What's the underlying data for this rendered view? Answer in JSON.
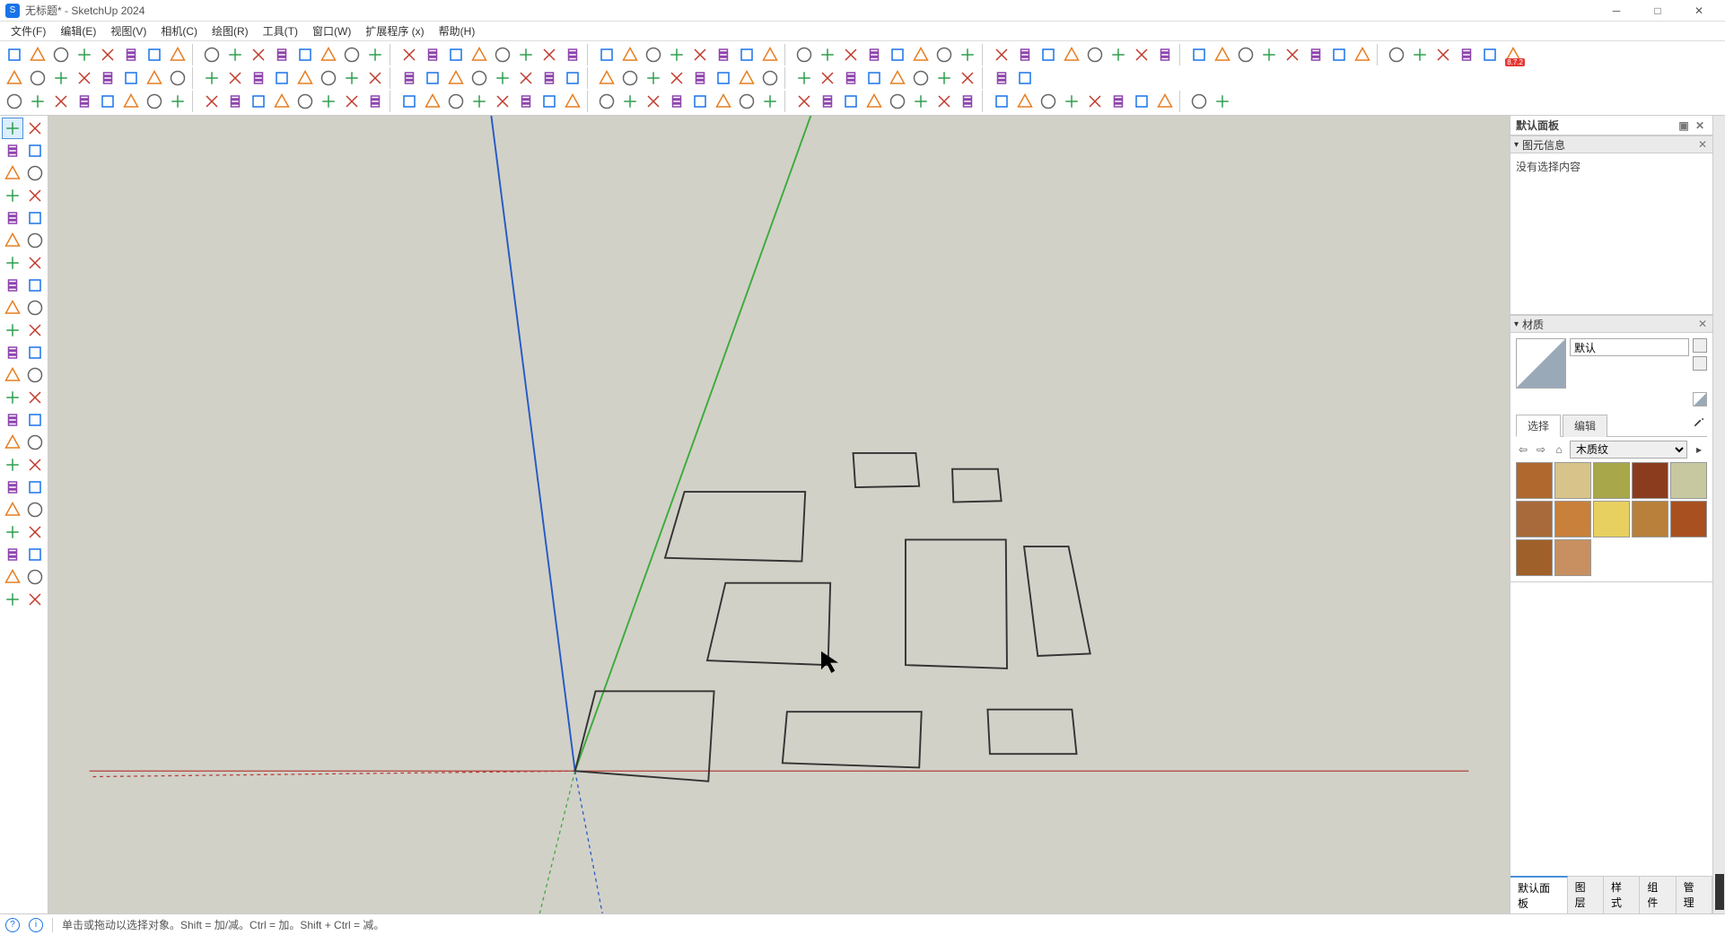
{
  "app": {
    "title": "无标题* - SketchUp 2024",
    "icon_letter": "S"
  },
  "menu": [
    {
      "label": "文件(F)",
      "key": "file"
    },
    {
      "label": "编辑(E)",
      "key": "edit"
    },
    {
      "label": "视图(V)",
      "key": "view"
    },
    {
      "label": "相机(C)",
      "key": "camera"
    },
    {
      "label": "绘图(R)",
      "key": "draw"
    },
    {
      "label": "工具(T)",
      "key": "tools"
    },
    {
      "label": "窗口(W)",
      "key": "window"
    },
    {
      "label": "扩展程序 (x)",
      "key": "ext"
    },
    {
      "label": "帮助(H)",
      "key": "help"
    }
  ],
  "ext_badge": "8.7.2",
  "tray": {
    "title": "默认面板",
    "entity_panel": {
      "title": "图元信息",
      "body": "没有选择内容"
    },
    "material_panel": {
      "title": "材质",
      "default_name": "默认",
      "tabs": [
        "选择",
        "编辑"
      ],
      "active_tab": 0,
      "library": "木质纹",
      "thumbs": [
        "#b0682f",
        "#d8c48a",
        "#a8a84a",
        "#8b3c1e",
        "#c8c8a0",
        "#a86a3a",
        "#c8803a",
        "#e8d060",
        "#b8803a",
        "#a85020",
        "#a0602a",
        "#c89060"
      ]
    },
    "bottom_tabs": [
      "默认面板",
      "图层",
      "样式",
      "组件",
      "管理"
    ],
    "bottom_active": 0
  },
  "status": {
    "hint": "单击或拖动以选择对象。Shift = 加/减。Ctrl = 加。Shift + Ctrl = 减。"
  },
  "left_tools": [
    [
      "select",
      "selector"
    ],
    [
      "eraser",
      "paint"
    ],
    [
      "box",
      "hex"
    ],
    [
      "line",
      "freehand"
    ],
    [
      "rect",
      "rotrect"
    ],
    [
      "circle",
      "poly"
    ],
    [
      "arc",
      "arc2"
    ],
    [
      "curve",
      "bezier"
    ],
    [
      "move",
      "movecopy"
    ],
    [
      "rotate",
      "scale"
    ],
    [
      "pushpull",
      "followme"
    ],
    [
      "offset",
      "intersect"
    ],
    [
      "tape",
      "protractor"
    ],
    [
      "dim",
      "text"
    ],
    [
      "axes",
      "section"
    ],
    [
      "orbit",
      "pan"
    ],
    [
      "zoom",
      "zoomwin"
    ],
    [
      "zoomext",
      "prev"
    ],
    [
      "walk",
      "look"
    ],
    [
      "position",
      "sound"
    ],
    [
      "sandbox1",
      "sandbox2"
    ],
    [
      "sandbox3",
      "sandbox4"
    ]
  ],
  "toolbar_rows": [
    62,
    42,
    50
  ]
}
